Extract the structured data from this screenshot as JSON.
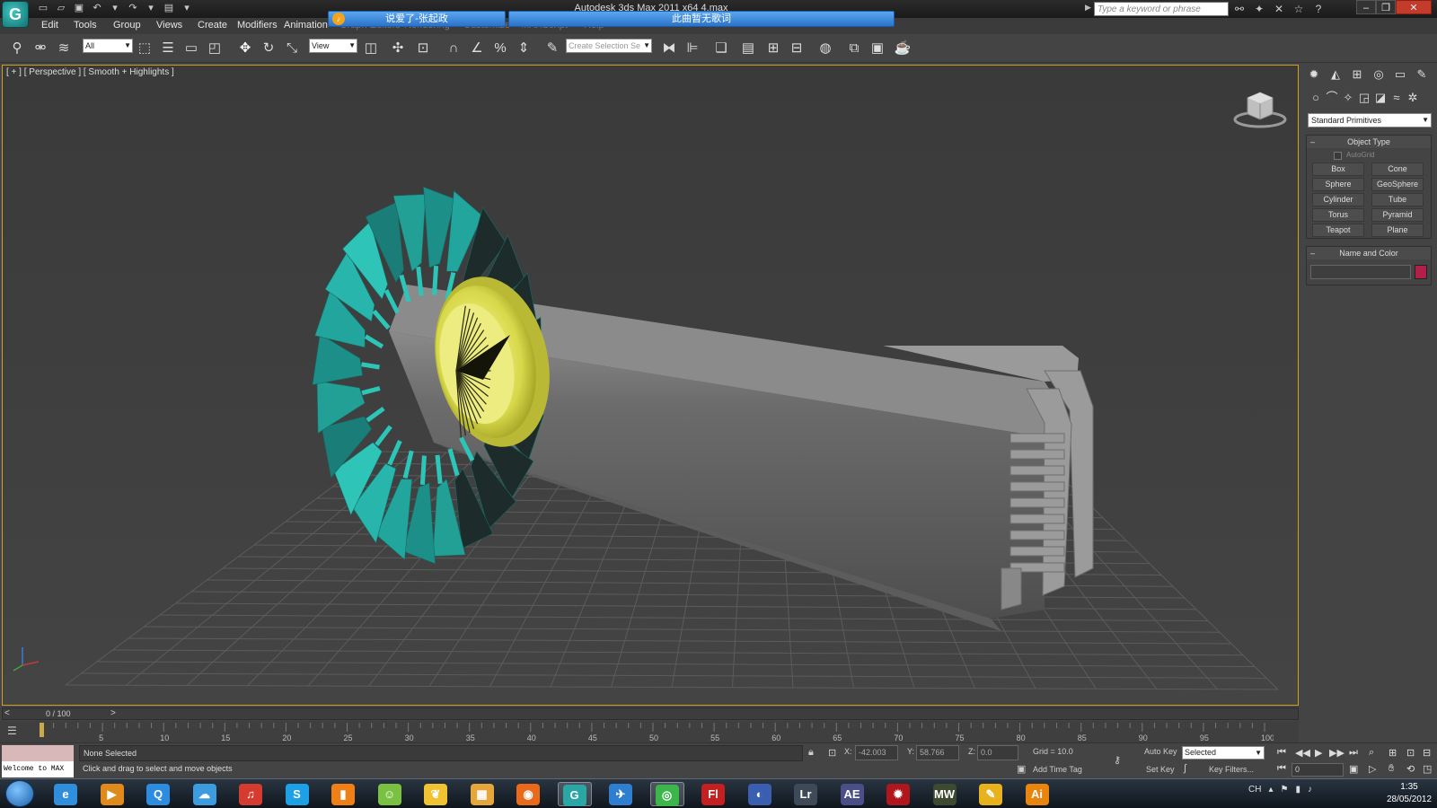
{
  "app": {
    "title": "Autodesk 3ds Max  2011 x64    4.max",
    "logo_glyph": "G"
  },
  "lyrics": {
    "left": "说爱了-张起政",
    "right": "此曲暂无歌词",
    "icon_glyph": "♪"
  },
  "menu": {
    "items": [
      "Edit",
      "Tools",
      "Group",
      "Views",
      "Create",
      "Modifiers",
      "Animation",
      "Graph Editors",
      "Rendering",
      "Customize",
      "MAXScript",
      "Help"
    ]
  },
  "search": {
    "placeholder": "Type a keyword or phrase"
  },
  "toolbar": {
    "selection_filter": "All",
    "ref_coord": "View",
    "named_selection": "Create Selection Se"
  },
  "viewport": {
    "label": "[ + ] [ Perspective ] [ Smooth + Highlights ]"
  },
  "command_panel": {
    "category": "Standard Primitives",
    "object_type_title": "Object Type",
    "autogrid_label": "AutoGrid",
    "primitives": [
      "Box",
      "Cone",
      "Sphere",
      "GeoSphere",
      "Cylinder",
      "Tube",
      "Torus",
      "Pyramid",
      "Teapot",
      "Plane"
    ],
    "name_color_title": "Name and Color",
    "swatch_color": "#b0204a"
  },
  "timeline": {
    "frame": "0 / 100",
    "prev": "<",
    "next": ">",
    "ticks": [
      "5",
      "10",
      "15",
      "20",
      "25",
      "30",
      "35",
      "40",
      "45",
      "50",
      "55",
      "60",
      "65",
      "70",
      "75",
      "80",
      "85",
      "90",
      "95",
      "100"
    ]
  },
  "status": {
    "script_listener": "Welcome to MAX",
    "selection": "None Selected",
    "prompt": "Click and drag to select and move objects",
    "x_label": "X:",
    "x_value": "-42.003",
    "y_label": "Y:",
    "y_value": "58.766",
    "z_label": "Z:",
    "z_value": "0.0",
    "grid": "Grid = 10.0",
    "add_time_tag": "Add Time Tag",
    "auto_key": "Auto Key",
    "set_key": "Set Key",
    "key_mode": "Selected",
    "key_filters": "Key Filters...",
    "current_frame": "0"
  },
  "taskbar": {
    "apps": [
      {
        "name": "ie-icon",
        "glyph": "e",
        "color": "#2f8fdc"
      },
      {
        "name": "media-player-icon",
        "glyph": "▶",
        "color": "#e08a1c"
      },
      {
        "name": "qq-browser-icon",
        "glyph": "Q",
        "color": "#2c8de0"
      },
      {
        "name": "messenger-icon",
        "glyph": "☁",
        "color": "#3d9be0"
      },
      {
        "name": "music-player-icon",
        "glyph": "♫",
        "color": "#d63b2f"
      },
      {
        "name": "skype-icon",
        "glyph": "S",
        "color": "#1ea0e6"
      },
      {
        "name": "office-icon",
        "glyph": "▮",
        "color": "#f07f16"
      },
      {
        "name": "qq-icon",
        "glyph": "☺",
        "color": "#7ac142"
      },
      {
        "name": "feather-icon",
        "glyph": "❦",
        "color": "#f1c232"
      },
      {
        "name": "folder-icon",
        "glyph": "▦",
        "color": "#e7a63c"
      },
      {
        "name": "firefox-icon",
        "glyph": "◉",
        "color": "#e86a1a"
      },
      {
        "name": "3dsmax-icon",
        "glyph": "G",
        "color": "#2aa7a5",
        "active": true
      },
      {
        "name": "bird-icon",
        "glyph": "✈",
        "color": "#2f7fd1"
      },
      {
        "name": "chrome-icon",
        "glyph": "◎",
        "color": "#3cb54a",
        "active": true
      },
      {
        "name": "flash-icon",
        "glyph": "Fl",
        "color": "#c61f1f"
      },
      {
        "name": "cinema4d-icon",
        "glyph": "◐",
        "color": "#3b5fb0"
      },
      {
        "name": "lightroom-icon",
        "glyph": "Lr",
        "color": "#3e4a57"
      },
      {
        "name": "aftereffects-icon",
        "glyph": "AE",
        "color": "#4a4f8a"
      },
      {
        "name": "game-icon",
        "glyph": "✹",
        "color": "#b0161b"
      },
      {
        "name": "nfs-icon",
        "glyph": "MW",
        "color": "#3d4a2f"
      },
      {
        "name": "paint-icon",
        "glyph": "✎",
        "color": "#e8b21e"
      },
      {
        "name": "illustrator-icon",
        "glyph": "Ai",
        "color": "#e8850f"
      }
    ],
    "tray_lang": "CH",
    "time": "1:35",
    "date": "28/05/2012"
  }
}
